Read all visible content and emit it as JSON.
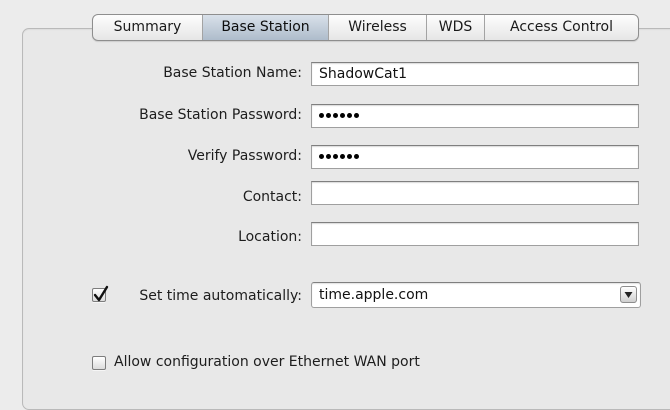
{
  "tabs": [
    {
      "label": "Summary"
    },
    {
      "label": "Base Station",
      "selected": true
    },
    {
      "label": "Wireless"
    },
    {
      "label": "WDS"
    },
    {
      "label": "Access Control"
    }
  ],
  "form": {
    "base_station_name": {
      "label": "Base Station Name:",
      "value": "ShadowCat1"
    },
    "base_station_password": {
      "label": "Base Station Password:",
      "masked_length": 6
    },
    "verify_password": {
      "label": "Verify Password:",
      "masked_length": 6
    },
    "contact": {
      "label": "Contact:",
      "value": ""
    },
    "location": {
      "label": "Location:",
      "value": ""
    },
    "set_time": {
      "label": "Set time automatically:",
      "checked": true,
      "value": "time.apple.com"
    },
    "allow_wan_config": {
      "label": "Allow configuration over Ethernet WAN port",
      "checked": false
    }
  },
  "colors": {
    "window_bg": "#ececec",
    "selected_tab": "#aebccb"
  }
}
